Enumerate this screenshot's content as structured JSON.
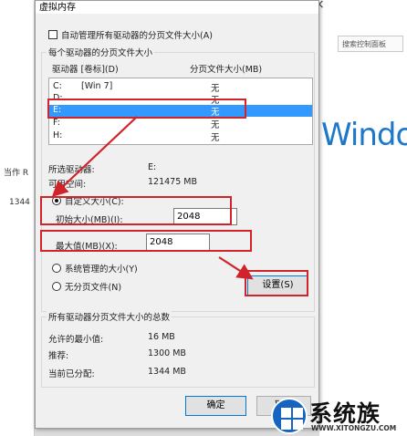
{
  "background": {
    "left_texts": [
      "当作 R",
      "1344"
    ],
    "search_placeholder": "搜索控制面板",
    "brand_text": "Windo",
    "close_glyph": "×"
  },
  "dialog": {
    "title": "虚拟内存",
    "auto_manage_label": "自动管理所有驱动器的分页文件大小(A)",
    "auto_manage_checked": false,
    "group_title": "每个驱动器的分页文件大小",
    "list_headers": {
      "drive": "驱动器 [卷标](D)",
      "size": "分页文件大小(MB)"
    },
    "drives": [
      {
        "letter": "C:",
        "label": "[Win 7]",
        "size": "无"
      },
      {
        "letter": "D:",
        "label": "",
        "size": "无"
      },
      {
        "letter": "E:",
        "label": "",
        "size": "无",
        "selected": true
      },
      {
        "letter": "F:",
        "label": "",
        "size": "无"
      },
      {
        "letter": "H:",
        "label": "",
        "size": "无"
      }
    ],
    "selected_drive_label": "所选驱动器:",
    "selected_drive_value": "E:",
    "available_space_label": "可用空间:",
    "available_space_value": "121475 MB",
    "custom_size_label": "自定义大小(C):",
    "initial_size_label": "初始大小(MB)(I):",
    "initial_size_value": "2048",
    "max_size_label": "最大值(MB)(X):",
    "max_size_value": "2048",
    "system_managed_label": "系统管理的大小(Y)",
    "no_paging_label": "无分页文件(N)",
    "set_button": "设置(S)",
    "summary_title": "所有驱动器分页文件大小的总数",
    "min_allowed_label": "允许的最小值:",
    "min_allowed_value": "16 MB",
    "recommended_label": "推荐:",
    "recommended_value": "1300 MB",
    "current_label": "当前已分配:",
    "current_value": "1344 MB",
    "ok_button": "确定",
    "cancel_button": "取消"
  },
  "watermark": {
    "text": "系统族",
    "url": "WWW.XITONGZU.COM"
  },
  "colors": {
    "annotation_red": "#d0232a",
    "selection_blue": "#3399ff",
    "brand_blue": "#1e78c9"
  }
}
